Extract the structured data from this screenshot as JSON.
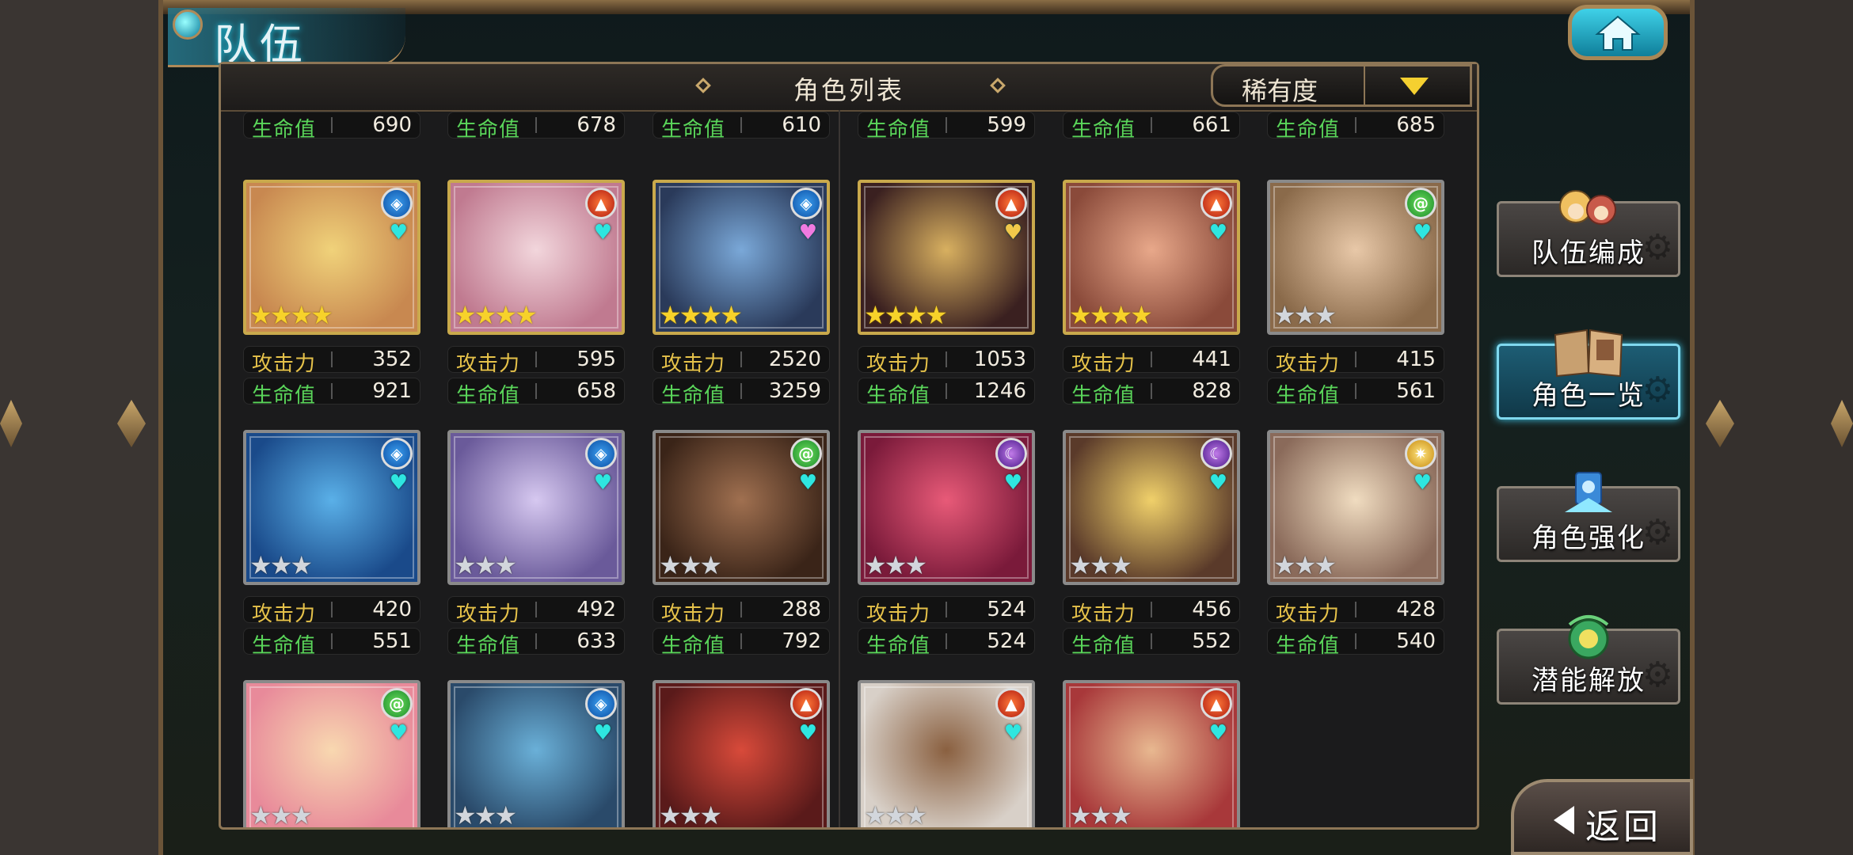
{
  "screen_title": "队伍",
  "panel": {
    "title": "角色列表",
    "sort": {
      "label": "稀有度"
    }
  },
  "stat_labels": {
    "attack": "攻击力",
    "hp": "生命值"
  },
  "partial_top_row_hp": [
    "690",
    "678",
    "610",
    "599",
    "661",
    "685"
  ],
  "characters": [
    {
      "element": "water",
      "heart": "cyan",
      "stars": "★★★★",
      "star_color": "gold",
      "frame": "gold",
      "atk": "352",
      "hp": "921",
      "tone": [
        "#f0d27a",
        "#c88850"
      ]
    },
    {
      "element": "fire",
      "heart": "cyan",
      "stars": "★★★★",
      "star_color": "gold",
      "frame": "gold",
      "atk": "595",
      "hp": "658",
      "tone": [
        "#f2d6dc",
        "#c07a90"
      ]
    },
    {
      "element": "water",
      "heart": "pink",
      "stars": "★★★★",
      "star_color": "gold",
      "frame": "gold",
      "atk": "2520",
      "hp": "3259",
      "tone": [
        "#7aa8d8",
        "#2a3a5a"
      ]
    },
    {
      "element": "fire",
      "heart": "gold",
      "stars": "★★★★",
      "star_color": "gold",
      "frame": "gold",
      "atk": "1053",
      "hp": "1246",
      "tone": [
        "#d8b060",
        "#3a2020"
      ]
    },
    {
      "element": "fire",
      "heart": "cyan",
      "stars": "★★★★",
      "star_color": "gold",
      "frame": "gold",
      "atk": "441",
      "hp": "828",
      "tone": [
        "#e8a88a",
        "#8a4a3a"
      ]
    },
    {
      "element": "wind",
      "heart": "cyan",
      "stars": "★★★",
      "star_color": "silver",
      "frame": "silver",
      "atk": "415",
      "hp": "561",
      "tone": [
        "#e8c8a8",
        "#8a6a4a"
      ]
    },
    {
      "element": "water",
      "heart": "cyan",
      "stars": "★★★",
      "star_color": "silver",
      "frame": "silver",
      "atk": "420",
      "hp": "551",
      "tone": [
        "#5ab0e8",
        "#1a4a8a"
      ]
    },
    {
      "element": "water",
      "heart": "cyan",
      "stars": "★★★",
      "star_color": "silver",
      "frame": "silver",
      "atk": "492",
      "hp": "633",
      "tone": [
        "#d6c8f0",
        "#6a5a9a"
      ]
    },
    {
      "element": "wind",
      "heart": "cyan",
      "stars": "★★★",
      "star_color": "silver",
      "frame": "silver",
      "atk": "288",
      "hp": "792",
      "tone": [
        "#a07050",
        "#3a2418"
      ]
    },
    {
      "element": "dark",
      "heart": "cyan",
      "stars": "★★★",
      "star_color": "silver",
      "frame": "silver",
      "atk": "524",
      "hp": "524",
      "tone": [
        "#e85a78",
        "#7a1a3a"
      ]
    },
    {
      "element": "dark",
      "heart": "cyan",
      "stars": "★★★",
      "star_color": "silver",
      "frame": "silver",
      "atk": "456",
      "hp": "552",
      "tone": [
        "#f0d06a",
        "#5a3a2a"
      ]
    },
    {
      "element": "light",
      "heart": "cyan",
      "stars": "★★★",
      "star_color": "silver",
      "frame": "silver",
      "atk": "428",
      "hp": "540",
      "tone": [
        "#f0dcc0",
        "#8a6a5a"
      ]
    },
    {
      "element": "wind",
      "heart": "cyan",
      "stars": "★★★",
      "star_color": "silver",
      "frame": "silver",
      "atk": "",
      "hp": "",
      "tone": [
        "#f8d8b0",
        "#e88a9a"
      ]
    },
    {
      "element": "water",
      "heart": "cyan",
      "stars": "★★★",
      "star_color": "silver",
      "frame": "silver",
      "atk": "",
      "hp": "",
      "tone": [
        "#6ab0d8",
        "#2a4a6a"
      ]
    },
    {
      "element": "fire",
      "heart": "cyan",
      "stars": "★★★",
      "star_color": "silver",
      "frame": "silver",
      "atk": "",
      "hp": "",
      "tone": [
        "#d84a3a",
        "#5a1a1a"
      ]
    },
    {
      "element": "fire",
      "heart": "cyan",
      "stars": "★★★",
      "star_color": "silver",
      "frame": "silver",
      "atk": "",
      "hp": "",
      "tone": [
        "#8a6040",
        "#d8d0c8"
      ]
    },
    {
      "element": "fire",
      "heart": "cyan",
      "stars": "★★★",
      "star_color": "silver",
      "frame": "silver",
      "atk": "",
      "hp": "",
      "tone": [
        "#e8b890",
        "#a8383a"
      ]
    }
  ],
  "side_menu": [
    {
      "label": "队伍编成",
      "icon": "party-members-icon",
      "active": false
    },
    {
      "label": "角色一览",
      "icon": "open-book-icon",
      "active": true
    },
    {
      "label": "角色强化",
      "icon": "enhance-crystal-icon",
      "active": false
    },
    {
      "label": "潜能解放",
      "icon": "potential-orb-icon",
      "active": false
    }
  ],
  "back_button": {
    "label": "返回"
  },
  "colors": {
    "hp_label": "#5ad65a",
    "atk_label": "#e6c24a",
    "accent": "#3fd1e8",
    "frame_gold": "#c9a94c"
  }
}
